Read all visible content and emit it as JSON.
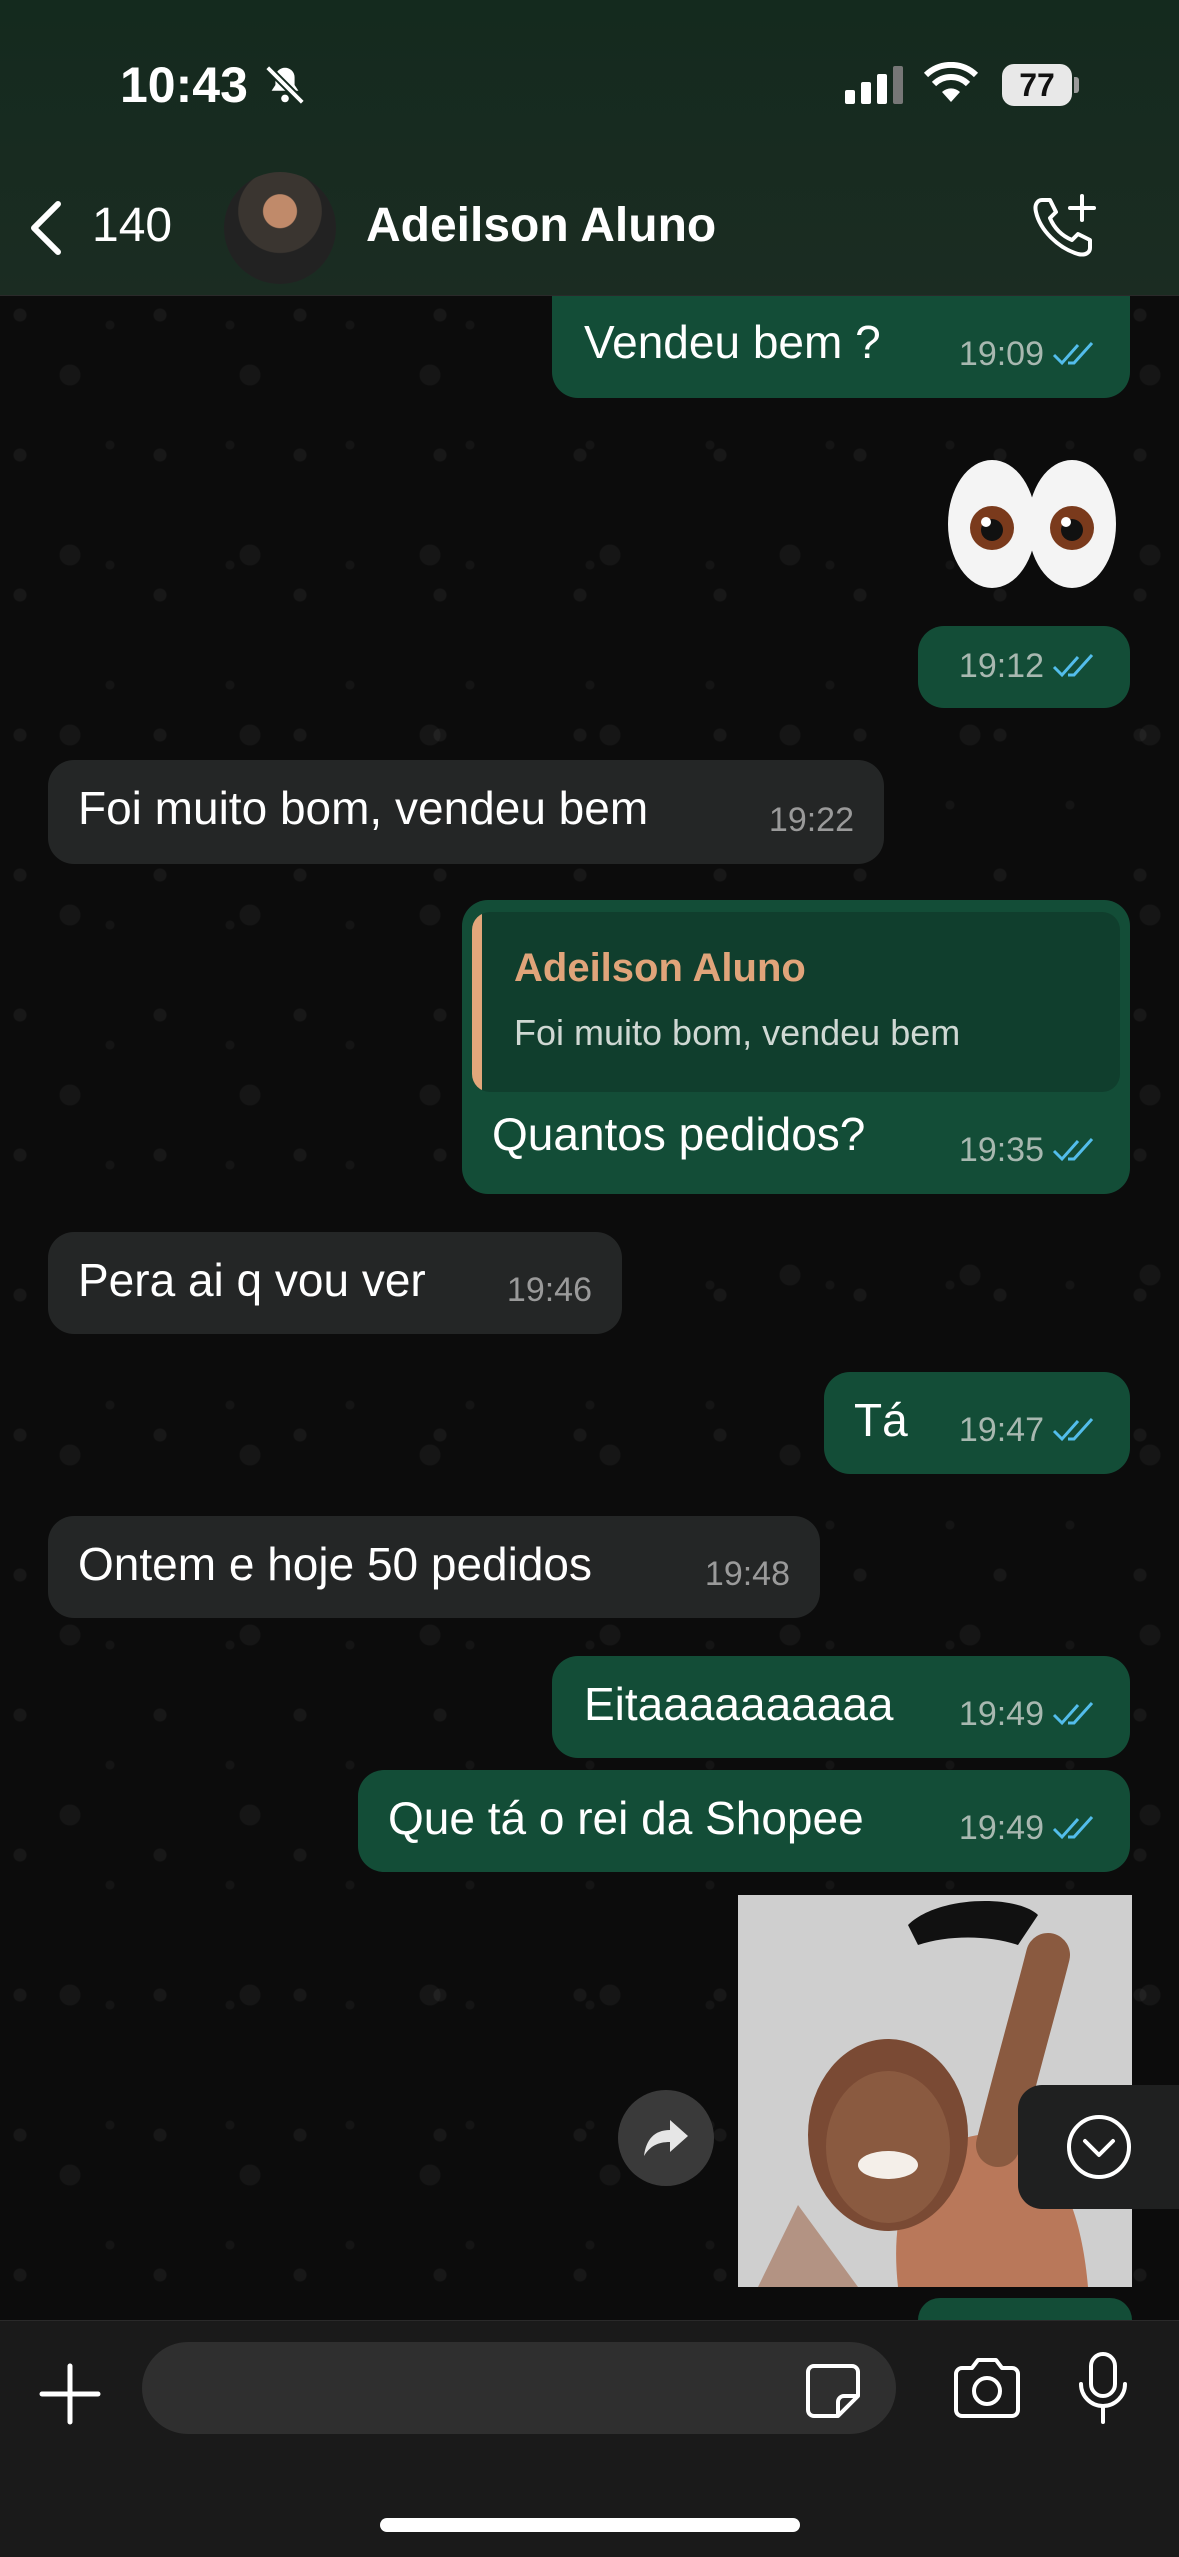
{
  "status_bar": {
    "time": "10:43",
    "battery": "77"
  },
  "header": {
    "back_count": "140",
    "contact_name": "Adeilson Aluno"
  },
  "messages": [
    {
      "dir": "out",
      "text": "Vendeu bem ?",
      "time": "19:09"
    },
    {
      "dir": "out",
      "emoji": "👀",
      "time": "19:12"
    },
    {
      "dir": "in",
      "text": "Foi muito bom, vendeu bem",
      "time": "19:22"
    },
    {
      "dir": "out",
      "reply_name": "Adeilson Aluno",
      "reply_text": "Foi muito bom, vendeu bem",
      "text": "Quantos pedidos?",
      "time": "19:35"
    },
    {
      "dir": "in",
      "text": "Pera ai q vou ver",
      "time": "19:46"
    },
    {
      "dir": "out",
      "text": "Tá",
      "time": "19:47"
    },
    {
      "dir": "in",
      "text": "Ontem e hoje 50 pedidos",
      "time": "19:48"
    },
    {
      "dir": "out",
      "text": "Eitaaaaaaaaaa",
      "time": "19:49"
    },
    {
      "dir": "out",
      "text": "Que tá o rei da Shopee",
      "time": "19:49"
    },
    {
      "dir": "out",
      "media": "image"
    }
  ],
  "composer": {
    "placeholder": ""
  },
  "colors": {
    "outgoing": "#134d37",
    "incoming": "#242626",
    "accent_reply": "#e2a77b",
    "read_ticks": "#53bdeb"
  }
}
